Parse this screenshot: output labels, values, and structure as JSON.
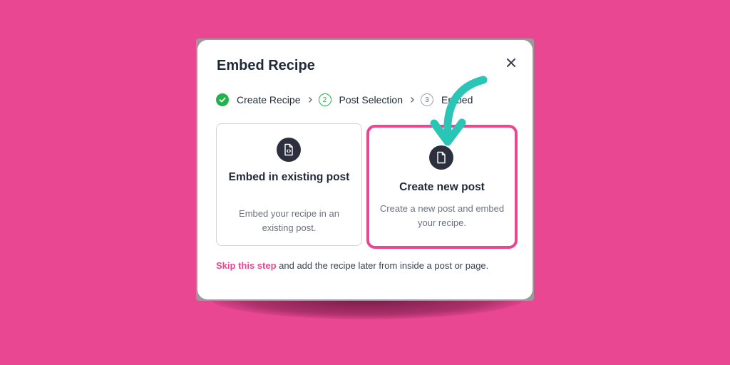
{
  "modal": {
    "title": "Embed Recipe",
    "close_icon": "close-icon"
  },
  "steps": [
    {
      "label": "Create Recipe",
      "state": "done",
      "icon": "check-icon"
    },
    {
      "label": "Post Selection",
      "state": "active",
      "number": "2"
    },
    {
      "label": "Embed",
      "state": "todo",
      "number": "3"
    }
  ],
  "separator_icon": "chevron-right-icon",
  "options": [
    {
      "title": "Embed in existing post",
      "description": "Embed your recipe in an existing post.",
      "icon": "file-code-icon",
      "selected": false
    },
    {
      "title": "Create new post",
      "description": "Create a new post and embed your recipe.",
      "icon": "file-icon",
      "selected": true
    }
  ],
  "footer": {
    "link_text": "Skip this step",
    "rest_text": " and add the recipe later from inside a post or page."
  },
  "colors": {
    "background": "#e94791",
    "highlight": "#e94791",
    "step_green": "#22b14c",
    "arrow_teal": "#2bc5b8",
    "icon_dark": "#2b2f3e"
  },
  "annotation": {
    "icon": "curved-arrow-icon"
  }
}
